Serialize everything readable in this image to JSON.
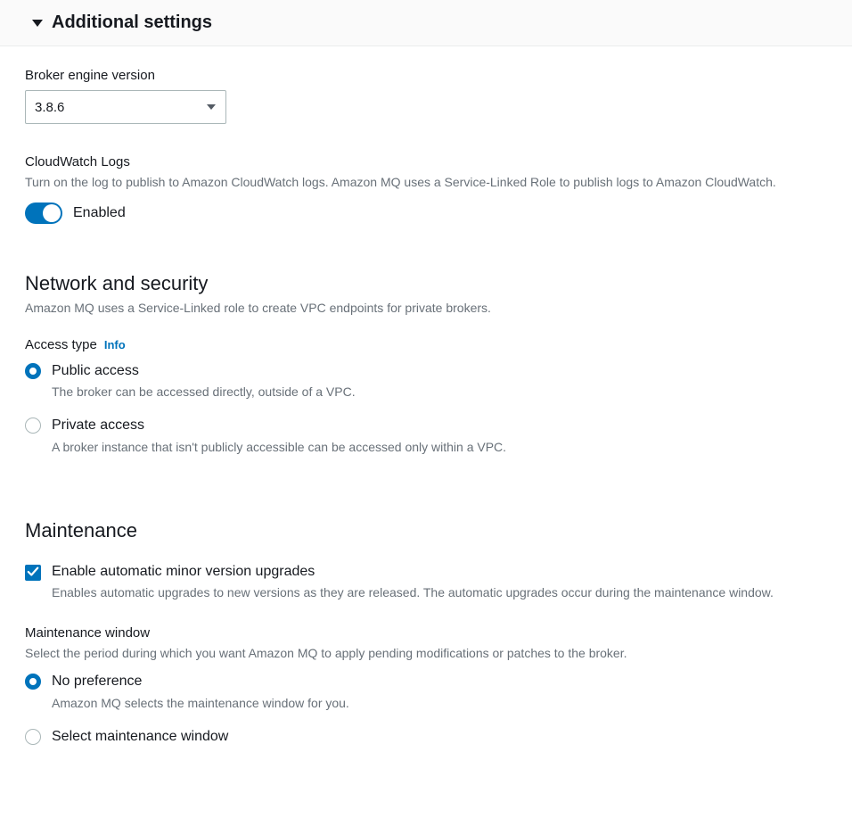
{
  "header": {
    "title": "Additional settings"
  },
  "brokerEngine": {
    "label": "Broker engine version",
    "value": "3.8.6"
  },
  "cloudwatch": {
    "heading": "CloudWatch Logs",
    "description": "Turn on the log to publish to Amazon CloudWatch logs. Amazon MQ uses a Service-Linked Role to publish logs to Amazon CloudWatch.",
    "toggleLabel": "Enabled"
  },
  "network": {
    "title": "Network and security",
    "description": "Amazon MQ uses a Service-Linked role to create VPC endpoints for private brokers.",
    "accessTypeLabel": "Access type",
    "infoLabel": "Info",
    "options": [
      {
        "title": "Public access",
        "desc": "The broker can be accessed directly, outside of a VPC.",
        "selected": true
      },
      {
        "title": "Private access",
        "desc": "A broker instance that isn't publicly accessible can be accessed only within a VPC.",
        "selected": false
      }
    ]
  },
  "maintenance": {
    "title": "Maintenance",
    "checkbox": {
      "title": "Enable automatic minor version upgrades",
      "desc": "Enables automatic upgrades to new versions as they are released. The automatic upgrades occur during the maintenance window."
    },
    "windowLabel": "Maintenance window",
    "windowDesc": "Select the period during which you want Amazon MQ to apply pending modifications or patches to the broker.",
    "options": [
      {
        "title": "No preference",
        "desc": "Amazon MQ selects the maintenance window for you.",
        "selected": true
      },
      {
        "title": "Select maintenance window",
        "desc": "",
        "selected": false
      }
    ]
  }
}
